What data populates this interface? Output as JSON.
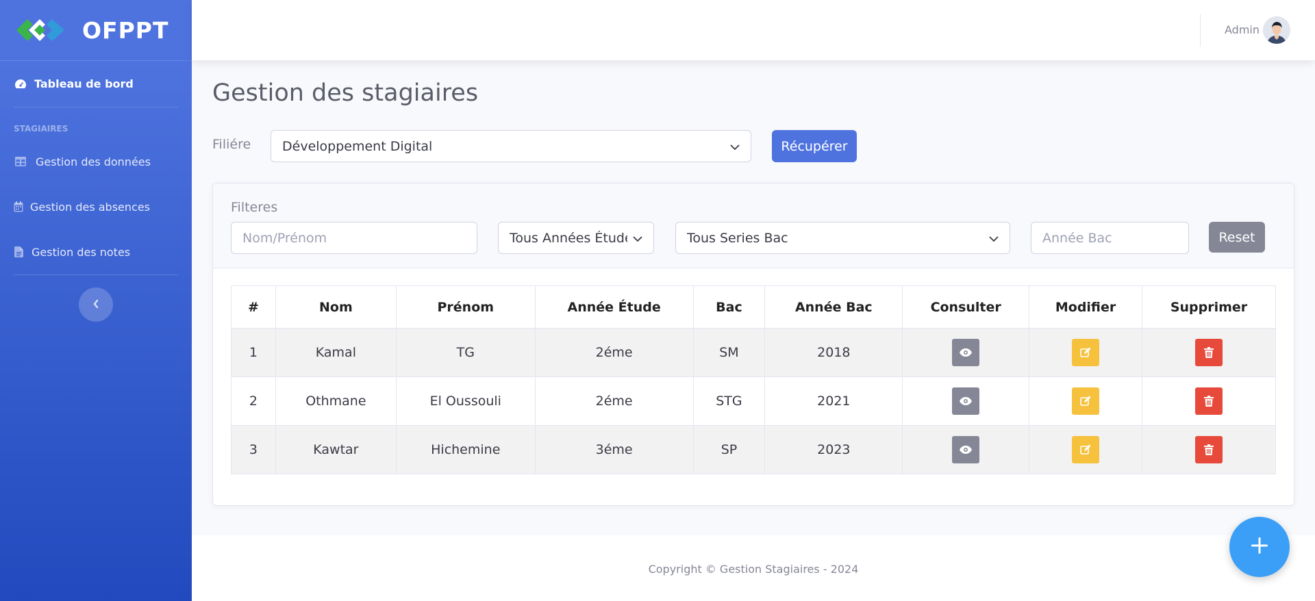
{
  "brand": {
    "name": "OFPPT",
    "logo_icon": "ofppt-logo"
  },
  "sidebar": {
    "dashboard": {
      "label": "Tableau de bord",
      "icon": "tachometer-icon"
    },
    "section_heading": "STAGIAIRES",
    "items": [
      {
        "label": "Gestion des données",
        "icon": "table-icon"
      },
      {
        "label": "Gestion des absences",
        "icon": "calendar-icon"
      },
      {
        "label": "Gestion des notes",
        "icon": "file-icon"
      }
    ],
    "toggle_icon": "chevron-left-icon"
  },
  "topbar": {
    "user_name": "Admin"
  },
  "page": {
    "title": "Gestion des stagiaires",
    "filiere_label": "Filiére",
    "filiere_value": "Développement Digital",
    "fetch_button": "Récupérer"
  },
  "filters": {
    "label": "Filteres",
    "name_placeholder": "Nom/Prénom",
    "annee_etude_value": "Tous Années Étude",
    "series_bac_value": "Tous Series Bac",
    "annee_bac_placeholder": "Année Bac",
    "reset_button": "Reset"
  },
  "table": {
    "headers": [
      "#",
      "Nom",
      "Prénom",
      "Année Étude",
      "Bac",
      "Année Bac",
      "Consulter",
      "Modifier",
      "Supprimer"
    ],
    "rows": [
      [
        "1",
        "Kamal",
        "TG",
        "2éme",
        "SM",
        "2018"
      ],
      [
        "2",
        "Othmane",
        "El Oussouli",
        "2éme",
        "STG",
        "2021"
      ],
      [
        "3",
        "Kawtar",
        "Hichemine",
        "3éme",
        "SP",
        "2023"
      ]
    ]
  },
  "footer": {
    "text": "Copyright © Gestion Stagiaires - 2024"
  },
  "colors": {
    "primary": "#4e73df",
    "secondary": "#858796",
    "warning": "#f6c23e",
    "danger": "#e74a3b",
    "fab": "#3b9ff7"
  }
}
